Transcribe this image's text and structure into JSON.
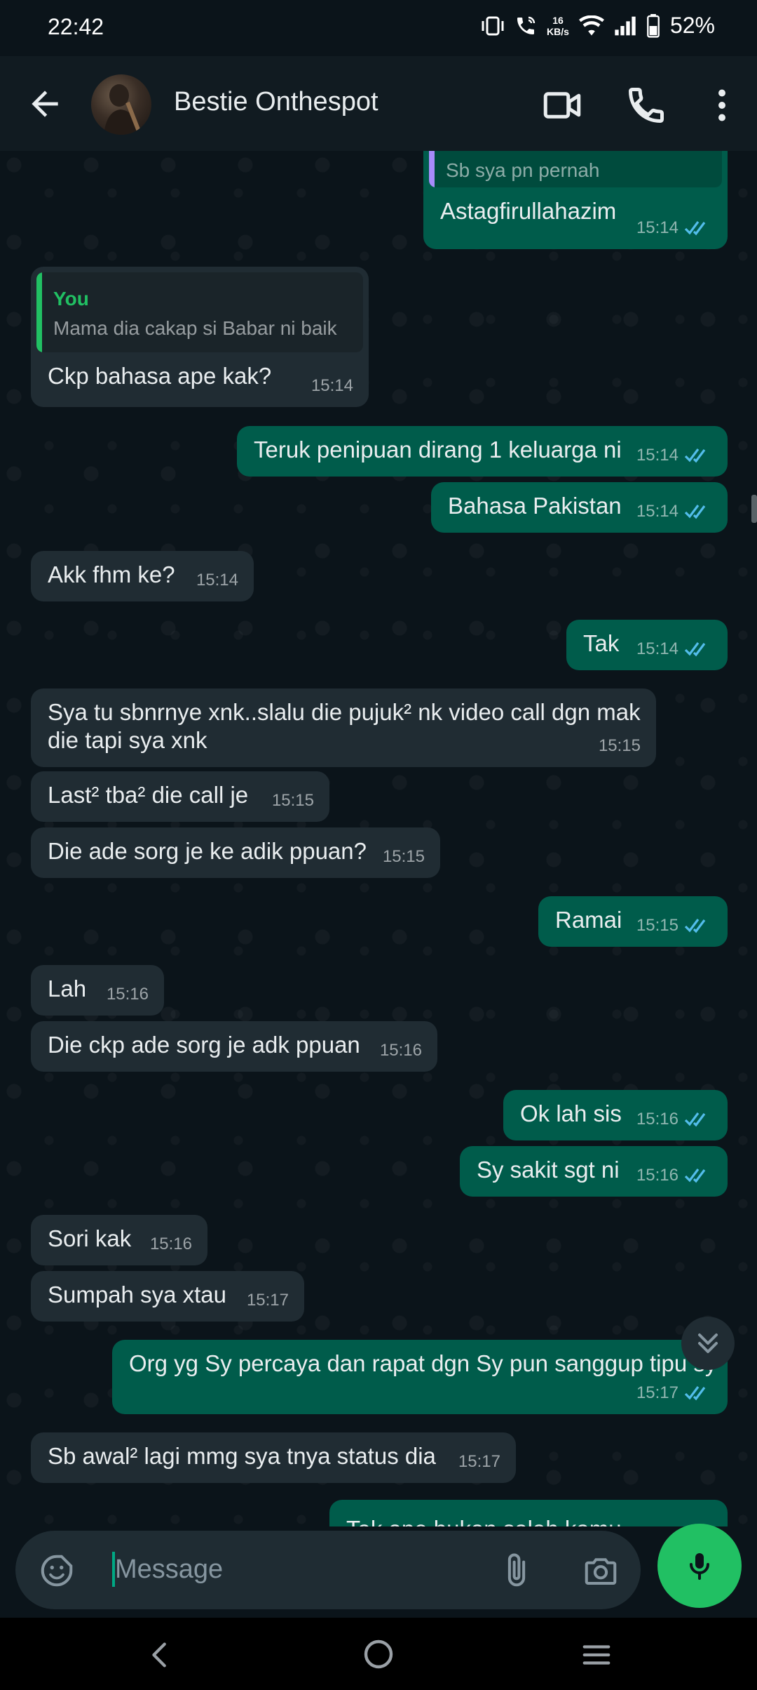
{
  "status_bar": {
    "time": "22:42",
    "speed_value": "16",
    "speed_unit": "KB/s",
    "battery": "52%"
  },
  "header": {
    "contact_name": "Bestie Onthespot"
  },
  "messages": [
    {
      "quote_text": "Sb sya pn pernah",
      "text": "Astagfirullahazim",
      "time": "15:14"
    },
    {
      "quote_author": "You",
      "quote_text": "Mama dia cakap si Babar ni baik",
      "text": "Ckp bahasa ape kak?",
      "time": "15:14"
    },
    {
      "text": "Teruk penipuan dirang 1 keluarga ni",
      "time": "15:14"
    },
    {
      "text": "Bahasa Pakistan",
      "time": "15:14"
    },
    {
      "text": "Akk fhm ke?",
      "time": "15:14"
    },
    {
      "text": "Tak",
      "time": "15:14"
    },
    {
      "line1": "Sya tu sbnrnye xnk..slalu die pujuk² nk video call dgn mak",
      "line2": "die tapi sya xnk",
      "time": "15:15"
    },
    {
      "text": "Last² tba² die call je",
      "time": "15:15"
    },
    {
      "text": "Die ade sorg je ke adik ppuan?",
      "time": "15:15"
    },
    {
      "text": "Ramai",
      "time": "15:15"
    },
    {
      "text": "Lah",
      "time": "15:16"
    },
    {
      "text": "Die ckp ade sorg je adk ppuan",
      "time": "15:16"
    },
    {
      "text": "Ok lah sis",
      "time": "15:16"
    },
    {
      "text": "Sy sakit sgt ni",
      "time": "15:16"
    },
    {
      "text": "Sori kak",
      "time": "15:16"
    },
    {
      "text": "Sumpah sya xtau",
      "time": "15:17"
    },
    {
      "text": "Org yg Sy percaya dan rapat dgn Sy pun sanggup tipu sy",
      "time": "15:17"
    },
    {
      "text": "Sb awal² lagi mmg sya tnya status dia",
      "time": "15:17"
    },
    {
      "text": "Tak ape bukan salah kamu"
    }
  ],
  "composer": {
    "placeholder": "Message"
  },
  "colors": {
    "outgoing": "#005c4b",
    "incoming": "#202c33",
    "accent": "#21c063",
    "read_ticks": "#53bdeb"
  }
}
